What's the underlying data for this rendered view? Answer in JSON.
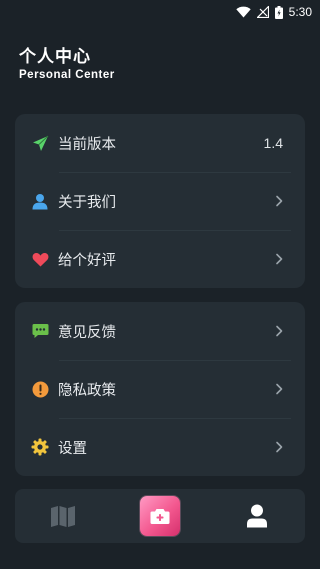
{
  "status_bar": {
    "time": "5:30"
  },
  "header": {
    "title": "个人中心",
    "subtitle": "Personal Center"
  },
  "card1": {
    "items": [
      {
        "label": "当前版本",
        "value": "1.4",
        "icon": "paper-plane-icon"
      },
      {
        "label": "关于我们",
        "icon": "user-icon"
      },
      {
        "label": "给个好评",
        "icon": "heart-icon"
      }
    ]
  },
  "card2": {
    "items": [
      {
        "label": "意见反馈",
        "icon": "chat-bubble-icon"
      },
      {
        "label": "隐私政策",
        "icon": "exclamation-icon"
      },
      {
        "label": "设置",
        "icon": "gear-icon"
      }
    ]
  },
  "bottom_nav": {
    "tabs": [
      {
        "name": "map",
        "icon": "map-icon"
      },
      {
        "name": "camera",
        "icon": "camera-icon"
      },
      {
        "name": "profile",
        "icon": "person-icon",
        "active": true
      }
    ]
  },
  "colors": {
    "background": "#1b2228",
    "card": "#252e35",
    "plane": "#59d36a",
    "user": "#4aa6ec",
    "heart": "#ef4a5a",
    "chat": "#6ac04a",
    "exclaim": "#f39a3c",
    "gear": "#f2c53d",
    "camera_gradient_start": "#ff9ac4",
    "camera_gradient_end": "#d5306c"
  }
}
